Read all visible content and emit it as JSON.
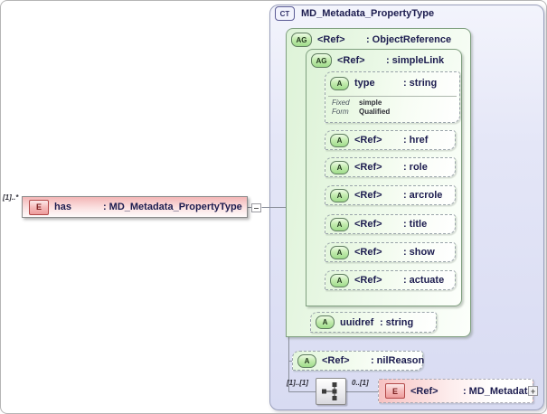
{
  "labels": {
    "colon": ":"
  },
  "source_element": {
    "cardinality": "[1]..*",
    "badge": "E",
    "name": "has",
    "type": "MD_Metadata_PropertyType"
  },
  "complex_type": {
    "badge": "CT",
    "title": "MD_Metadata_PropertyType",
    "object_reference": {
      "badge": "AG",
      "name": "<Ref>",
      "type": "ObjectReference",
      "simple_link": {
        "badge": "AG",
        "name": "<Ref>",
        "type": "simpleLink",
        "type_attribute": {
          "badge": "A",
          "name": "type",
          "type": "string",
          "facts": [
            {
              "label": "Fixed",
              "value": "simple"
            },
            {
              "label": "Form",
              "value": "Qualified"
            }
          ]
        },
        "attributes": [
          {
            "badge": "A",
            "name": "<Ref>",
            "type": "href"
          },
          {
            "badge": "A",
            "name": "<Ref>",
            "type": "role"
          },
          {
            "badge": "A",
            "name": "<Ref>",
            "type": "arcrole"
          },
          {
            "badge": "A",
            "name": "<Ref>",
            "type": "title"
          },
          {
            "badge": "A",
            "name": "<Ref>",
            "type": "show"
          },
          {
            "badge": "A",
            "name": "<Ref>",
            "type": "actuate"
          }
        ]
      },
      "uuidref_attribute": {
        "badge": "A",
        "name": "uuidref",
        "type": "string"
      }
    },
    "nil_reason_attribute": {
      "badge": "A",
      "name": "<Ref>",
      "type": "nilReason"
    },
    "sequence": {
      "cardinality": "[1]..[1]",
      "child_cardinality": "0..[1]",
      "element": {
        "badge": "E",
        "name": "<Ref>",
        "type": "MD_Metadata",
        "expand_icon": "+"
      }
    }
  },
  "colors": {
    "group_green": "#a0dc8b",
    "element_pink": "#f3b6b6",
    "container_lavender": "#d8dbf2",
    "line_gray": "#8a8f9b"
  }
}
